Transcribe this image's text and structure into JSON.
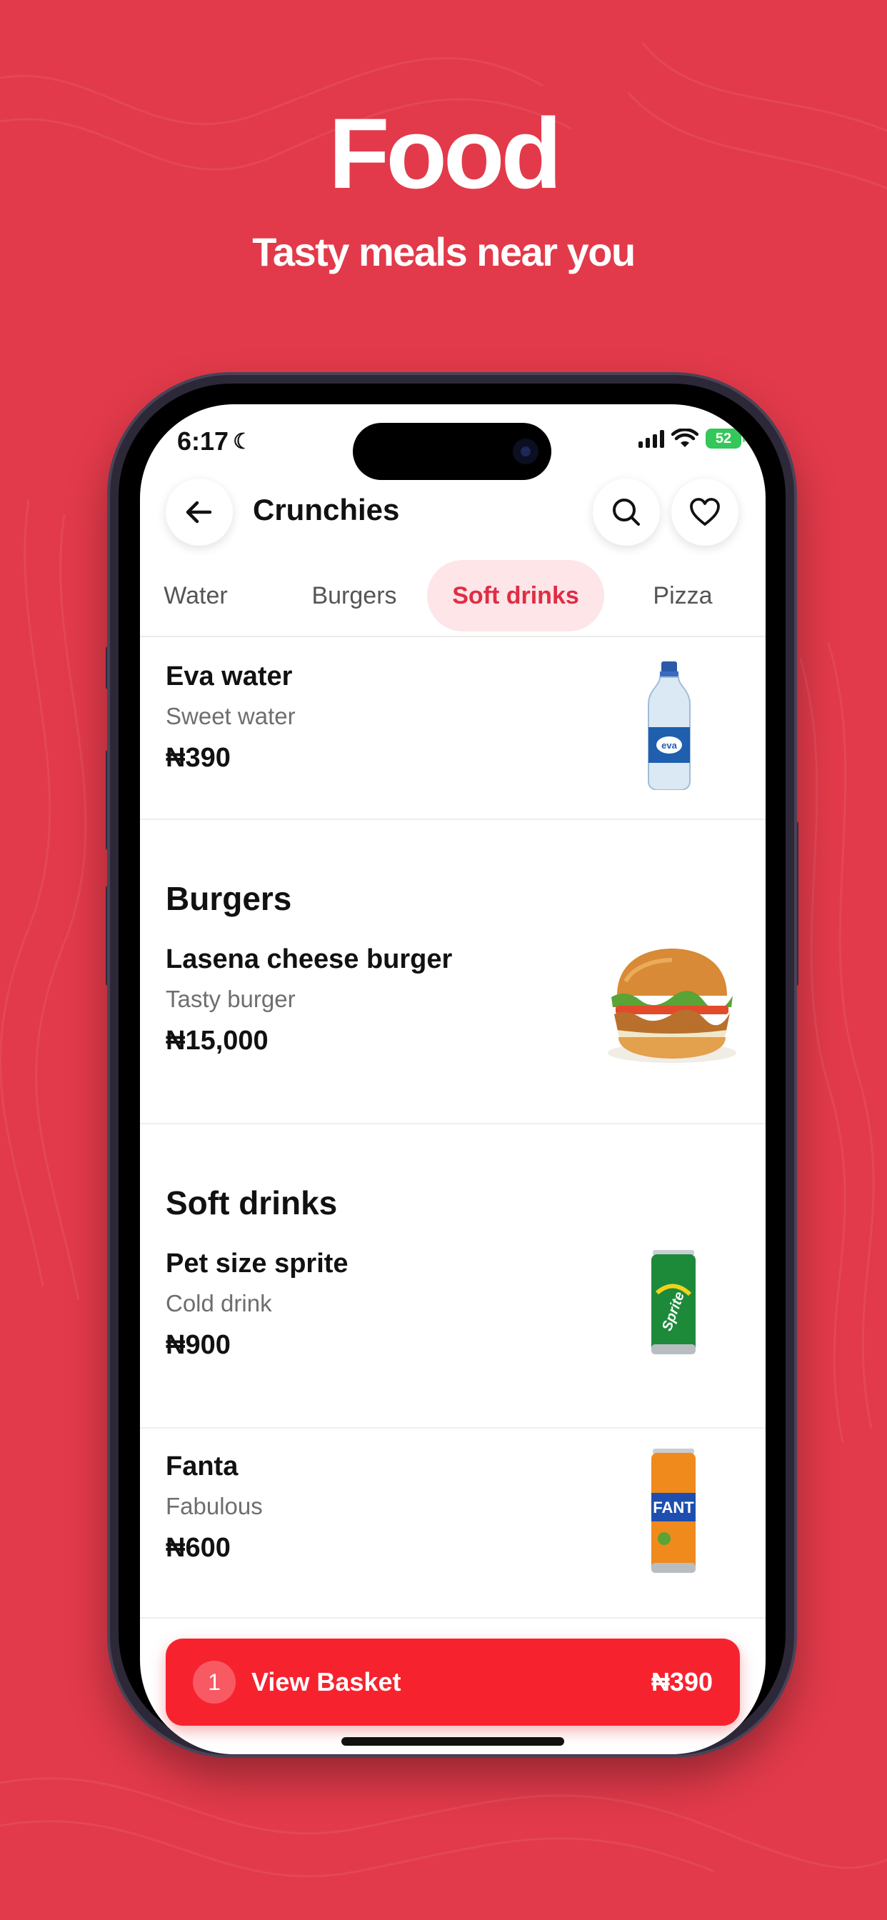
{
  "hero": {
    "title": "Food",
    "subtitle": "Tasty meals near you"
  },
  "status_bar": {
    "time": "6:17",
    "battery": "52"
  },
  "header": {
    "store_name": "Crunchies",
    "back_icon": "arrow-left-icon",
    "search_icon": "search-icon",
    "favorite_icon": "heart-icon"
  },
  "tabs": [
    {
      "label": "Water"
    },
    {
      "label": "Burgers"
    },
    {
      "label": "Soft drinks",
      "active": true
    },
    {
      "label": "Pizza"
    }
  ],
  "sections": [
    {
      "title": "",
      "items": [
        {
          "name": "Eva water",
          "description": "Sweet water",
          "price": "₦390",
          "image": "water-bottle"
        }
      ]
    },
    {
      "title": "Burgers",
      "items": [
        {
          "name": "Lasena cheese burger",
          "description": "Tasty burger",
          "price": "₦15,000",
          "image": "burger"
        }
      ]
    },
    {
      "title": "Soft drinks",
      "items": [
        {
          "name": "Pet size sprite",
          "description": "Cold drink",
          "price": "₦900",
          "image": "sprite-can"
        },
        {
          "name": "Fanta",
          "description": "Fabulous",
          "price": "₦600",
          "image": "fanta-can"
        }
      ]
    }
  ],
  "basket": {
    "count": "1",
    "label": "View Basket",
    "total": "₦390"
  },
  "colors": {
    "background": "#e23a4a",
    "accent": "#f6232f",
    "tab_active_bg": "#fde5e8",
    "tab_active_text": "#e02d44"
  }
}
